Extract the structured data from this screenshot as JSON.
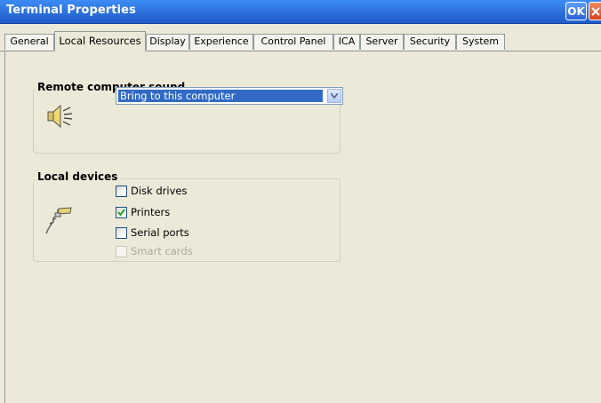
{
  "window": {
    "title": "Terminal Properties",
    "ok_label": "OK",
    "close_icon": "close-icon"
  },
  "tabs": [
    {
      "label": "General",
      "active": false
    },
    {
      "label": "Local Resources",
      "active": true
    },
    {
      "label": "Display",
      "active": false
    },
    {
      "label": "Experience",
      "active": false
    },
    {
      "label": "Control Panel",
      "active": false
    },
    {
      "label": "ICA",
      "active": false
    },
    {
      "label": "Server",
      "active": false
    },
    {
      "label": "Security",
      "active": false
    },
    {
      "label": "System",
      "active": false
    }
  ],
  "sound_group": {
    "title": "Remote computer sound",
    "icon": "speaker-icon",
    "dropdown_value": "Bring to this computer"
  },
  "devices_group": {
    "title": "Local devices",
    "icon": "plug-icon",
    "items": [
      {
        "label": "Disk drives",
        "checked": false,
        "enabled": true
      },
      {
        "label": "Printers",
        "checked": true,
        "enabled": true
      },
      {
        "label": "Serial ports",
        "checked": false,
        "enabled": true
      },
      {
        "label": "Smart cards",
        "checked": false,
        "enabled": false
      }
    ]
  },
  "colors": {
    "titlebar": "#2f74de",
    "selection": "#316ac5",
    "dialog_bg": "#ece9d8"
  }
}
